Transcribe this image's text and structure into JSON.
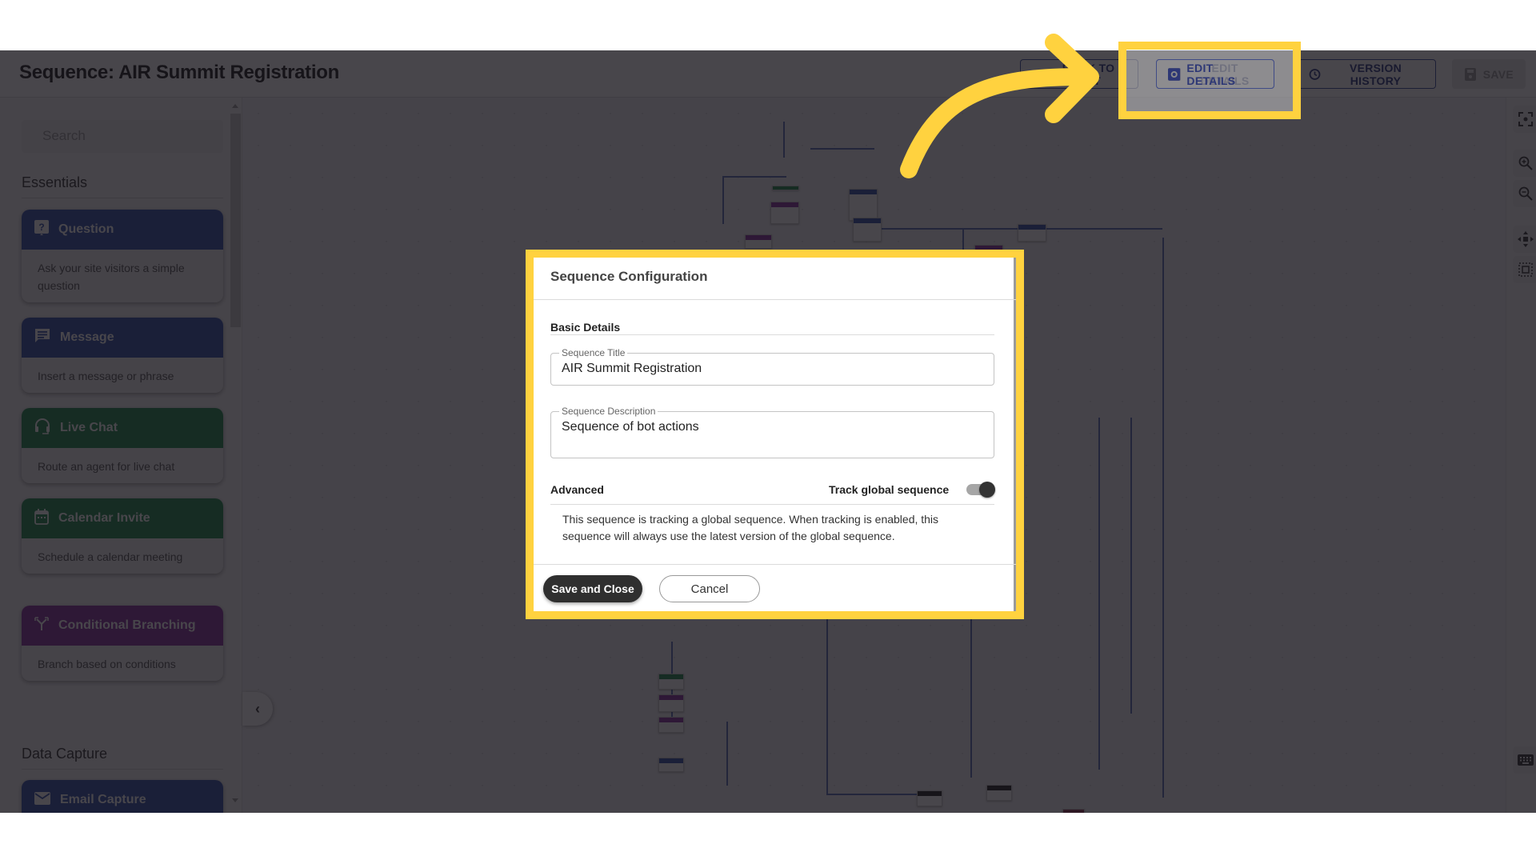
{
  "header": {
    "title": "Sequence: AIR Summit Registration",
    "buttons": {
      "back": "BACK TO BOT",
      "edit_details": "EDIT DETAILS",
      "version_history": "VERSION HISTORY",
      "save": "SAVE"
    }
  },
  "sidebar": {
    "search_placeholder": "Search",
    "sections": [
      {
        "label": "Essentials",
        "items": [
          {
            "title": "Question",
            "description": "Ask your site visitors a simple question",
            "icon": "question-icon",
            "color": "#2f4fa8"
          },
          {
            "title": "Message",
            "description": "Insert a message or phrase",
            "icon": "message-icon",
            "color": "#2f4fa8"
          },
          {
            "title": "Live Chat",
            "description": "Route an agent for live chat",
            "icon": "headset-icon",
            "color": "#1f8a4c"
          },
          {
            "title": "Calendar Invite",
            "description": "Schedule a calendar meeting",
            "icon": "calendar-icon",
            "color": "#1f8a4c"
          },
          {
            "title": "Conditional Branching",
            "description": "Branch based on conditions",
            "icon": "branch-icon",
            "color": "#8a2d9e"
          }
        ]
      },
      {
        "label": "Data Capture",
        "items": [
          {
            "title": "Email Capture",
            "description": "",
            "icon": "email-icon",
            "color": "#2f4fa8"
          }
        ]
      }
    ]
  },
  "canvas_tools": [
    "fit-view-icon",
    "zoom-in-icon",
    "zoom-out-icon",
    "pan-icon",
    "select-area-icon",
    "keyboard-icon"
  ],
  "modal": {
    "title": "Sequence Configuration",
    "basic_details_heading": "Basic Details",
    "sequence_title": {
      "label": "Sequence Title",
      "value": "AIR Summit Registration"
    },
    "sequence_description": {
      "label": "Sequence Description",
      "value": "Sequence of bot actions"
    },
    "advanced_heading": "Advanced",
    "track_global_label": "Track global sequence",
    "track_global_enabled": true,
    "note": "This sequence is tracking a global sequence. When tracking is enabled, this sequence will always use the latest version of the global sequence.",
    "save_label": "Save and Close",
    "cancel_label": "Cancel"
  },
  "annotation": {
    "highlight_color": "#ffd23f",
    "target": "EDIT DETAILS"
  }
}
